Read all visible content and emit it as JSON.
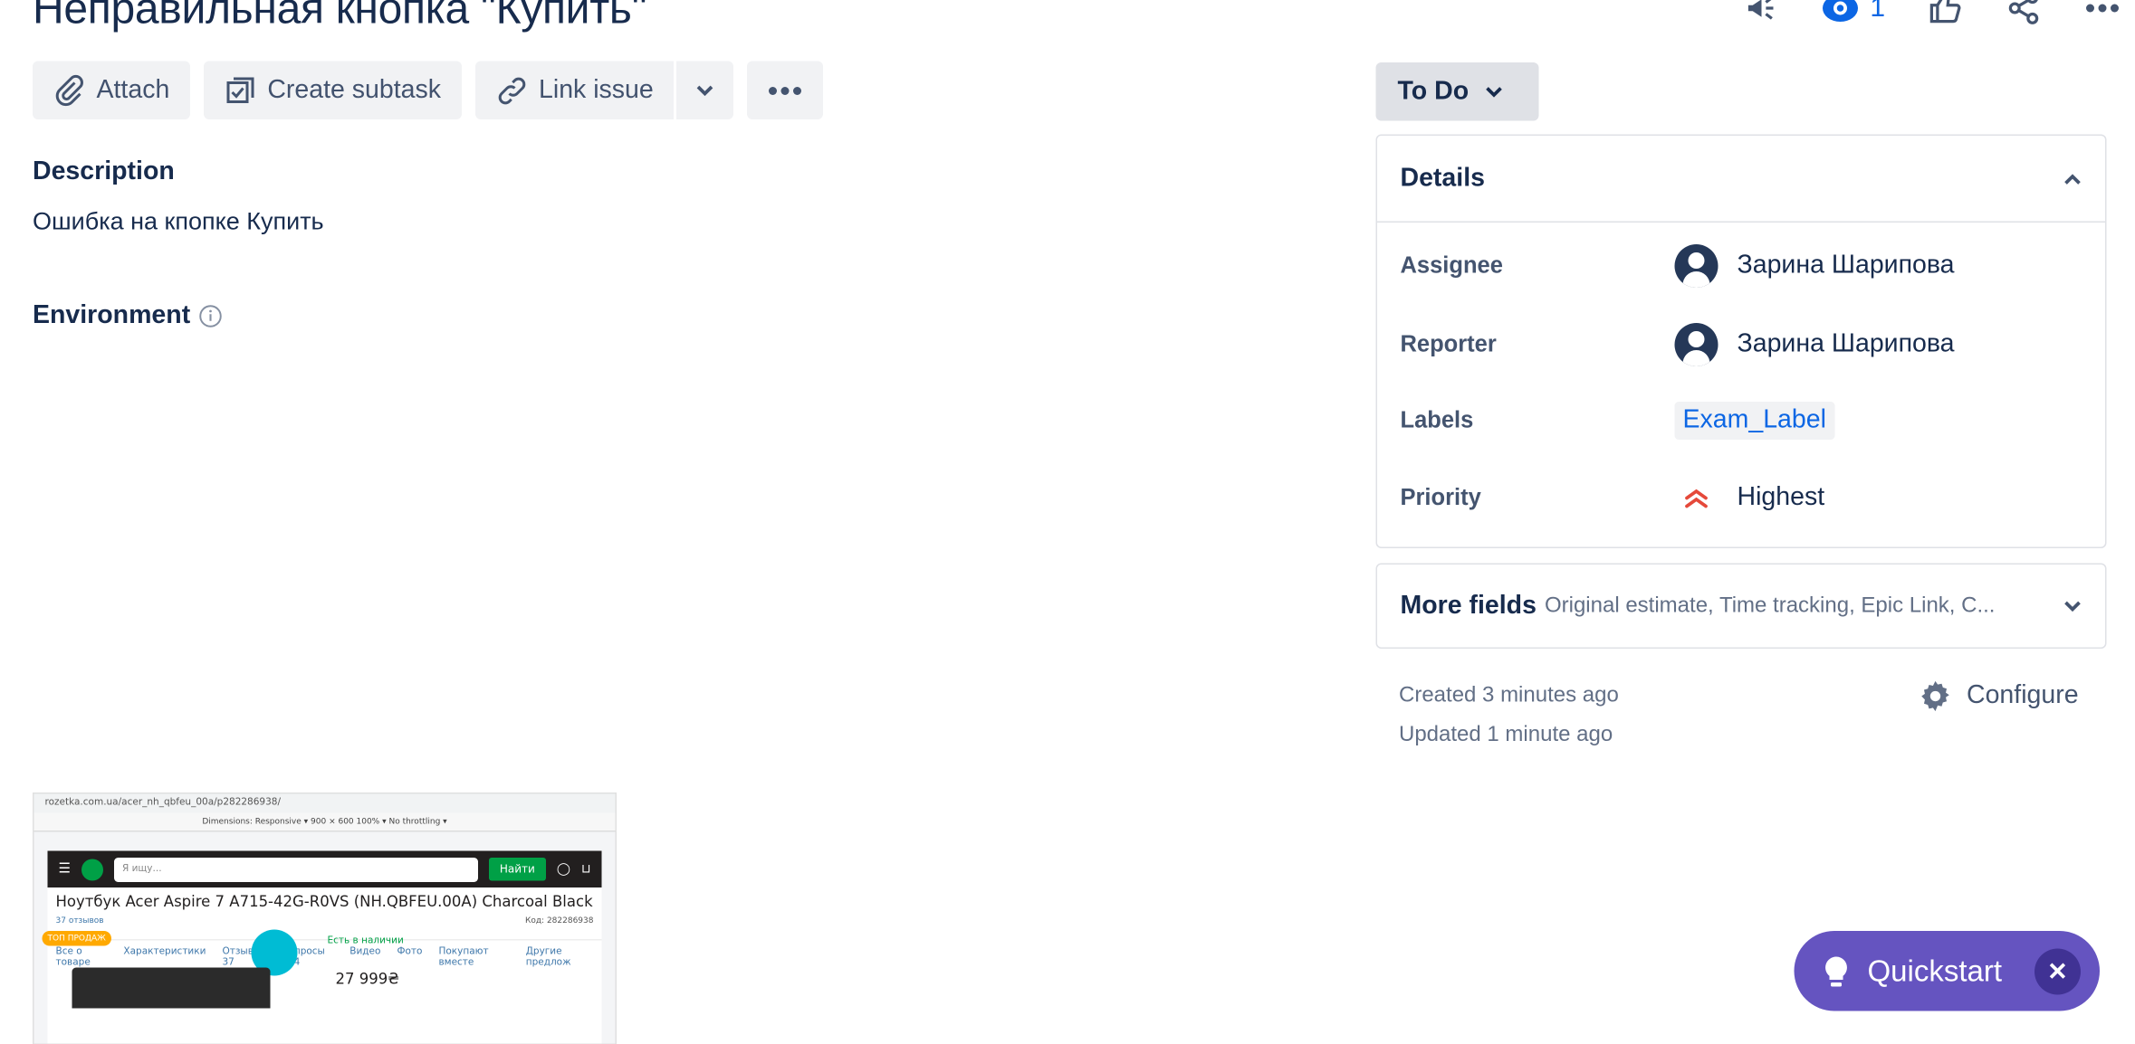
{
  "issue": {
    "title": "Неправильная кнопка \"Купить\""
  },
  "top_actions": {
    "watch_count": "1"
  },
  "toolbar": {
    "attach_label": "Attach",
    "subtask_label": "Create subtask",
    "link_label": "Link issue"
  },
  "description": {
    "heading": "Description",
    "text": "Ошибка на кпопке Купить"
  },
  "environment": {
    "heading": "Environment"
  },
  "attachment": {
    "address": "rozetka.com.ua/acer_nh_qbfeu_00a/p282286938/",
    "devtools": "Dimensions: Responsive ▾   900  ×  600    100% ▾   No throttling ▾",
    "search_placeholder": "Я ищу...",
    "find_label": "Найти",
    "product_title": "Ноутбук Acer Aspire 7 A715-42G-R0VS (NH.QBFEU.00A) Charcoal Black",
    "reviews": "37 отзывов",
    "code": "Код:  282286938",
    "tabs": [
      "Все о товаре",
      "Характеристики",
      "Отзывы 37",
      "Вопросы 134",
      "Видео",
      "Фото",
      "Покупают вместе",
      "Другие предлож"
    ],
    "top_badge": "ТОП ПРОДАЖ",
    "stock": "Есть в наличии",
    "price": "27 999₴"
  },
  "status": {
    "label": "To Do"
  },
  "details": {
    "heading": "Details",
    "rows": [
      {
        "label": "Assignee",
        "value": "Зарина Шарипова"
      },
      {
        "label": "Reporter",
        "value": "Зарина Шарипова"
      },
      {
        "label": "Labels",
        "value": "Exam_Label"
      },
      {
        "label": "Priority",
        "value": "Highest"
      }
    ]
  },
  "more_fields": {
    "title": "More fields",
    "subtitle": "Original estimate, Time tracking, Epic Link, C..."
  },
  "meta": {
    "created": "Created 3 minutes ago",
    "updated": "Updated 1 minute ago",
    "configure": "Configure"
  },
  "quickstart": {
    "label": "Quickstart"
  },
  "colors": {
    "accent": "#0c66e4",
    "quickstart": "#6554c0",
    "priority_highest": "#e5493a"
  }
}
